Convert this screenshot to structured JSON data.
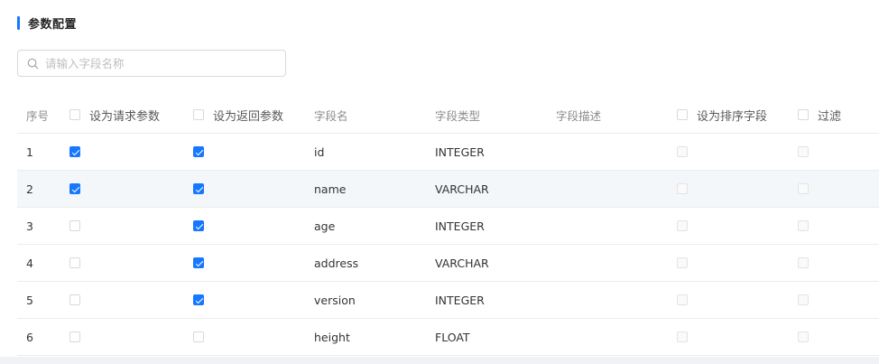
{
  "section": {
    "title": "参数配置"
  },
  "search": {
    "placeholder": "请输入字段名称",
    "value": ""
  },
  "table": {
    "headers": {
      "index": "序号",
      "request": "设为请求参数",
      "return": "设为返回参数",
      "field_name": "字段名",
      "field_type": "字段类型",
      "field_desc": "字段描述",
      "sort": "设为排序字段",
      "filter": "过滤"
    },
    "rows": [
      {
        "index": "1",
        "request": true,
        "return": true,
        "name": "id",
        "type": "INTEGER",
        "desc": "",
        "sort": false,
        "filter": false
      },
      {
        "index": "2",
        "request": true,
        "return": true,
        "name": "name",
        "type": "VARCHAR",
        "desc": "",
        "sort": false,
        "filter": false
      },
      {
        "index": "3",
        "request": false,
        "return": true,
        "name": "age",
        "type": "INTEGER",
        "desc": "",
        "sort": false,
        "filter": false
      },
      {
        "index": "4",
        "request": false,
        "return": true,
        "name": "address",
        "type": "VARCHAR",
        "desc": "",
        "sort": false,
        "filter": false
      },
      {
        "index": "5",
        "request": false,
        "return": true,
        "name": "version",
        "type": "INTEGER",
        "desc": "",
        "sort": false,
        "filter": false
      },
      {
        "index": "6",
        "request": false,
        "return": false,
        "name": "height",
        "type": "FLOAT",
        "desc": "",
        "sort": false,
        "filter": false
      }
    ]
  },
  "colors": {
    "accent": "#1677ff",
    "striped_row": "#f4f7fa",
    "border": "#ececec"
  }
}
